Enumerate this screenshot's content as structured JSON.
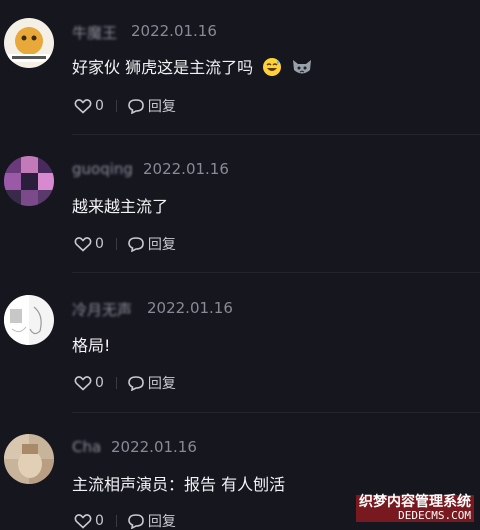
{
  "comments": [
    {
      "username": "牛魔王",
      "date": "2022.01.16",
      "text": "好家伙 狮虎这是主流了吗",
      "emojis": [
        "grinning-sweat-emoji",
        "cat-face-emoji"
      ],
      "likes": "0",
      "reply_label": "回复"
    },
    {
      "username": "guoqing",
      "date": "2022.01.16",
      "text": "越来越主流了",
      "likes": "0",
      "reply_label": "回复"
    },
    {
      "username": "冷月无声",
      "date": "2022.01.16",
      "text": "格局!",
      "likes": "0",
      "reply_label": "回复"
    },
    {
      "username": "Cha",
      "date": "2022.01.16",
      "text": "主流相声演员：报告 有人刨活",
      "likes": "0",
      "reply_label": "回复"
    }
  ],
  "watermark": {
    "line1": "织梦内容管理系统",
    "line2": "DEDECMS.COM"
  },
  "colors": {
    "background": "#16161f",
    "meta_text": "#8a8a96",
    "body_text": "#f2f2f5"
  }
}
